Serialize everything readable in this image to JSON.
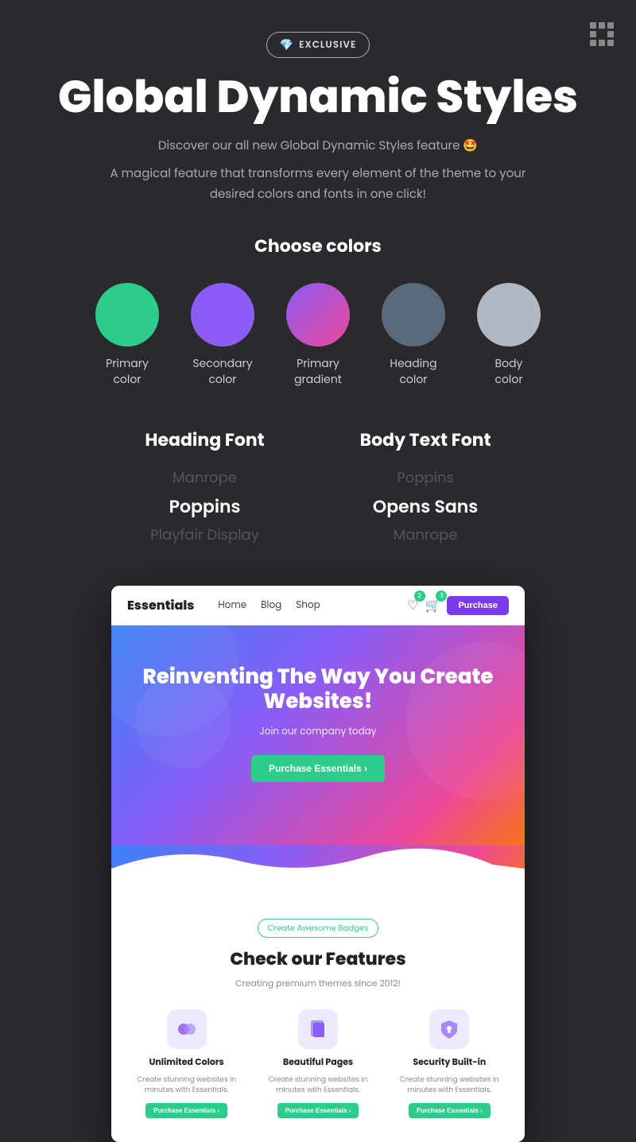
{
  "topLogo": {
    "ariaLabel": "logo-icon"
  },
  "badge": {
    "icon": "💎",
    "label": "EXCLUSIVE"
  },
  "hero": {
    "title": "Global Dynamic Styles",
    "subtitle1": "Discover our all new Global Dynamic Styles feature 🤩",
    "subtitle2": "A magical feature that transforms every element of the theme to your desired colors and fonts in one click!"
  },
  "colorsSection": {
    "title": "Choose colors",
    "circles": [
      {
        "id": "primary",
        "label": "Primary\ncolor",
        "cssClass": "circle-primary"
      },
      {
        "id": "secondary",
        "label": "Secondary\ncolor",
        "cssClass": "circle-secondary"
      },
      {
        "id": "gradient",
        "label": "Primary\ngradient",
        "cssClass": "circle-gradient"
      },
      {
        "id": "heading",
        "label": "Heading\ncolor",
        "cssClass": "circle-heading"
      },
      {
        "id": "body",
        "label": "Body\ncolor",
        "cssClass": "circle-body"
      }
    ]
  },
  "fontsSection": {
    "headingFont": {
      "title": "Heading Font",
      "fonts": [
        "Manrope",
        "Poppins",
        "Playfair Display"
      ],
      "activeIndex": 1
    },
    "bodyFont": {
      "title": "Body Text Font",
      "fonts": [
        "Poppins",
        "Opens Sans",
        "Manrope"
      ],
      "activeIndex": 1
    }
  },
  "preview": {
    "nav": {
      "logo": "Essentials",
      "links": [
        "Home",
        "Blog",
        "Shop"
      ],
      "wishlistCount": "2",
      "cartCount": "3",
      "purchaseBtn": "Purchase"
    },
    "heroSection": {
      "title": "Reinventing The Way You Create Websites!",
      "subtitle": "Join our company today",
      "ctaBtn": "Purchase Essentials ›"
    },
    "featuresSection": {
      "badge": "Create Awesome Badges",
      "title": "Check our Features",
      "subtitle": "Creating premium themes since 2012!",
      "features": [
        {
          "icon": "🎨",
          "name": "Unlimited Colors",
          "desc": "Create stunning websites in minutes with Essentials.",
          "btn": "Purchase Essentials ›"
        },
        {
          "icon": "📄",
          "name": "Beautiful Pages",
          "desc": "Create stunning websites in minutes with Essentials.",
          "btn": "Purchase Essentials ›"
        },
        {
          "icon": "🔒",
          "name": "Security Built-in",
          "desc": "Create stunning websites in minutes with Essentials.",
          "btn": "Purchase Essentials ›"
        }
      ]
    }
  }
}
